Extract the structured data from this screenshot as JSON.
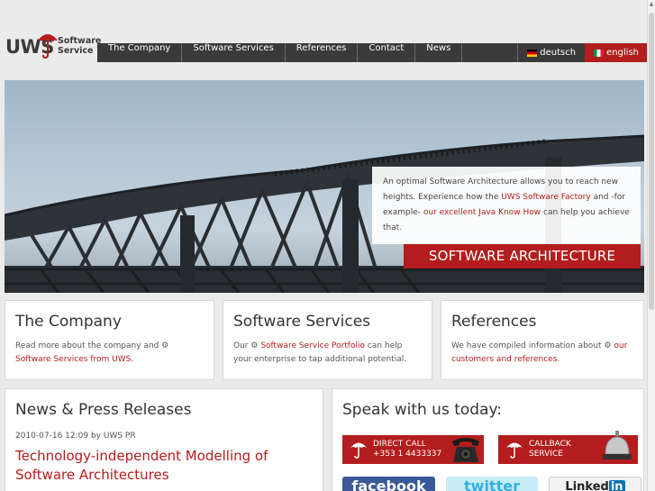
{
  "logo": {
    "brand": "UWS",
    "line1": "Software",
    "line2": "Service"
  },
  "nav": {
    "items": [
      "The Company",
      "Software Services",
      "References",
      "Contact",
      "News"
    ],
    "lang_de": "deutsch",
    "lang_en": "english"
  },
  "hero": {
    "text_pre": "An optimal Software Architecture allows you to reach new heights. Experience how the ",
    "link1": "UWS Software Factory",
    "text_mid": " and -for example- ",
    "link2": "our excellent Java Know How",
    "text_post": " can help you achieve that.",
    "banner": "SOFTWARE ARCHITECTURE"
  },
  "boxes": {
    "company": {
      "title": "The Company",
      "text": "Read more about the company and ",
      "link": "Software Services from UWS",
      "end": "."
    },
    "services": {
      "title": "Software Services",
      "text": "Our ",
      "link": "Software Service Portfolio",
      "end": " can help your enterprise to tap additional potential."
    },
    "references": {
      "title": "References",
      "text": "We have compiled information about ",
      "link": "our customers and references",
      "end": "."
    }
  },
  "news": {
    "title": "News & Press Releases",
    "meta": "2010-07-16 12:09 by UWS PR",
    "headline": "Technology-independent Modelling of Software Architectures"
  },
  "speak": {
    "title": "Speak with us today:",
    "direct_line1": "DIRECT CALL",
    "direct_line2": "+353 1 4433337",
    "callback_line1": "CALLBACK",
    "callback_line2": "SERVICE",
    "facebook": "facebook",
    "twitter": "twitter",
    "linkedin_text": "Linked",
    "linkedin_badge": "in"
  },
  "colors": {
    "accent": "#b31d1d",
    "nav_bg": "#3a3a3a",
    "page_bg": "#ebebeb"
  }
}
